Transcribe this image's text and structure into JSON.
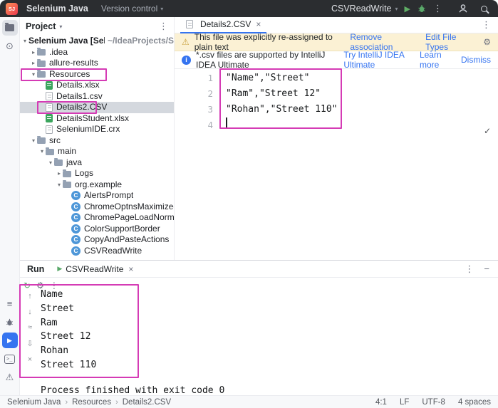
{
  "titlebar": {
    "logo": "SJ",
    "project_button": "Selenium Java",
    "vcs_button": "Version control",
    "run_config": "CSVReadWrite"
  },
  "icons": {
    "chevron_down": "▾",
    "chevron_right": "▸",
    "more": "⋮",
    "play": "▶",
    "gear": "⚙",
    "warning": "⚠",
    "info_letter": "i",
    "check": "✓",
    "close": "×",
    "minimize": "−",
    "rerun": "↻",
    "commit": "⊙",
    "structure": "≡",
    "problems": "⚠",
    "up": "↑",
    "down": "↓",
    "soft_wrap": "≈",
    "scroll_end": "⇩",
    "clear": "×",
    "breadcrumb_sep": "›",
    "class_letter": "C",
    "terminal_text": ">_"
  },
  "colors": {
    "annotation_magenta": "#d53bb5",
    "accent_blue": "#3574f0",
    "run_green": "#59a869",
    "titlebar_bg": "#2b2d30",
    "warning_banner_bg": "#fbf1d4"
  },
  "project_panel": {
    "title": "Project",
    "tree": [
      {
        "label": "Selenium Java [SeleniumJava]",
        "path_suffix": "~/IdeaProjects/S",
        "level": 0,
        "icon": "none",
        "chevron": "expanded",
        "bold": true
      },
      {
        "label": ".idea",
        "level": 1,
        "icon": "folder",
        "chevron": "collapsed"
      },
      {
        "label": "allure-results",
        "level": 1,
        "icon": "folder",
        "chevron": "collapsed"
      },
      {
        "label": "Resources",
        "level": 1,
        "icon": "folder",
        "chevron": "expanded",
        "annotated": true
      },
      {
        "label": "Details.xlsx",
        "level": 2,
        "icon": "excel"
      },
      {
        "label": "Details1.csv",
        "level": 2,
        "icon": "text"
      },
      {
        "label": "Details2.CSV",
        "level": 2,
        "icon": "text",
        "selected": true,
        "annotated": true
      },
      {
        "label": "DetailsStudent.xlsx",
        "level": 2,
        "icon": "excel"
      },
      {
        "label": "SeleniumIDE.crx",
        "level": 2,
        "icon": "text"
      },
      {
        "label": "src",
        "level": 1,
        "icon": "folder",
        "chevron": "expanded"
      },
      {
        "label": "main",
        "level": 2,
        "icon": "folder",
        "chevron": "expanded"
      },
      {
        "label": "java",
        "level": 3,
        "icon": "folder",
        "chevron": "expanded"
      },
      {
        "label": "Logs",
        "level": 4,
        "icon": "folder",
        "chevron": "collapsed"
      },
      {
        "label": "org.example",
        "level": 4,
        "icon": "package",
        "chevron": "expanded"
      },
      {
        "label": "AlertsPrompt",
        "level": 5,
        "icon": "class"
      },
      {
        "label": "ChromeOptnsMaximized",
        "level": 5,
        "icon": "class"
      },
      {
        "label": "ChromePageLoadNormal",
        "level": 5,
        "icon": "class"
      },
      {
        "label": "ColorSupportBorder",
        "level": 5,
        "icon": "class"
      },
      {
        "label": "CopyAndPasteActions",
        "level": 5,
        "icon": "class"
      },
      {
        "label": "CSVReadWrite",
        "level": 5,
        "icon": "class"
      }
    ]
  },
  "editor": {
    "tab": {
      "label": "Details2.CSV"
    },
    "warning_banner": {
      "text": "This file was explicitly re-assigned to plain text",
      "actions": [
        "Remove association",
        "Edit File Types"
      ]
    },
    "info_banner": {
      "text": "*.csv files are supported by IntelliJ IDEA Ultimate",
      "actions": [
        "Try IntelliJ IDEA Ultimate",
        "Learn more",
        "Dismiss"
      ]
    },
    "lines": [
      {
        "num": "1",
        "code": "\"Name\",\"Street\""
      },
      {
        "num": "2",
        "code": "\"Ram\",\"Street 12\""
      },
      {
        "num": "3",
        "code": "\"Rohan\",\"Street 110\""
      },
      {
        "num": "4",
        "code": "",
        "caret": true
      }
    ]
  },
  "run_panel": {
    "title": "Run",
    "tab": "CSVReadWrite",
    "output": [
      "Name",
      "Street",
      "Ram",
      "Street 12",
      "Rohan",
      "Street 110"
    ],
    "process_line": "Process finished with exit code 0"
  },
  "statusbar": {
    "breadcrumbs": [
      "Selenium Java",
      "Resources",
      "Details2.CSV"
    ],
    "caret": "4:1",
    "line_separator": "LF",
    "encoding": "UTF-8",
    "indent": "4 spaces"
  }
}
